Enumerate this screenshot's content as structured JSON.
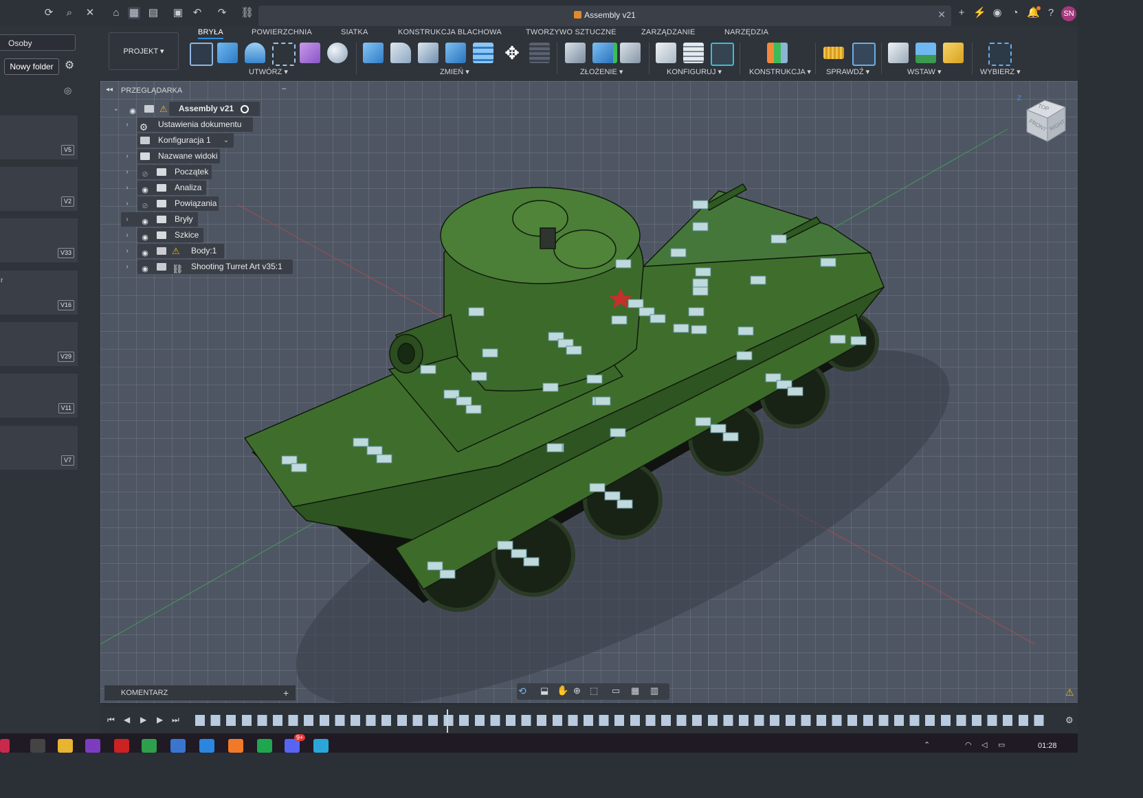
{
  "window": {
    "doc_title": "Assembly v21",
    "avatar_initials": "SN"
  },
  "left_panel": {
    "people_label": "Osoby",
    "new_folder_label": "Nowy folder",
    "cards": [
      {
        "label": "",
        "version": "V5"
      },
      {
        "label": "",
        "version": "V2"
      },
      {
        "label": "",
        "version": "V33"
      },
      {
        "label": "r",
        "version": "V16"
      },
      {
        "label": "",
        "version": "V29"
      },
      {
        "label": "",
        "version": "V11"
      },
      {
        "label": "",
        "version": "V7"
      }
    ]
  },
  "toolbar": {
    "tabs": [
      "BRYŁA",
      "POWIERZCHNIA",
      "SIATKA",
      "KONSTRUKCJA BLACHOWA",
      "TWORZYWO SZTUCZNE",
      "ZARZĄDZANIE",
      "NARZĘDZIA"
    ],
    "active_tab": "BRYŁA",
    "workspace": "PROJEKT ▾",
    "groups": [
      "UTWÓRZ ▾",
      "ZMIEŃ ▾",
      "ZŁOŻENIE ▾",
      "KONFIGURUJ ▾",
      "KONSTRUKCJA ▾",
      "SPRAWDŹ ▾",
      "WSTAW ▾",
      "WYBIERZ ▾"
    ]
  },
  "browser": {
    "header": "PRZEGLĄDARKA",
    "root": "Assembly v21",
    "items": [
      {
        "label": "Ustawienia dokumentu",
        "icon": "gear-icon"
      },
      {
        "label": "Konfiguracja 1",
        "icon": "config-icon"
      },
      {
        "label": "Nazwane widoki",
        "icon": "folder-icon"
      },
      {
        "label": "Początek",
        "icon": "folder-icon"
      },
      {
        "label": "Analiza",
        "icon": "folder-icon"
      },
      {
        "label": "Powiązania",
        "icon": "folder-icon"
      },
      {
        "label": "Bryły",
        "icon": "folder-icon"
      },
      {
        "label": "Szkice",
        "icon": "folder-icon"
      },
      {
        "label": "Body:1",
        "icon": "component-icon"
      },
      {
        "label": "Shooting Turret Art v35:1",
        "icon": "link-icon"
      }
    ]
  },
  "comments": {
    "label": "KOMENTARZ"
  },
  "viewcube": {
    "top": "TOP",
    "front": "FRONT",
    "right": "RIGHT",
    "z_axis": "Z"
  },
  "taskbar": {
    "time": "01:28",
    "badge": "9+"
  },
  "colors": {
    "accent": "#2f8fdc",
    "tank_green": "#3d6b2c",
    "warning": "#f5b400"
  }
}
